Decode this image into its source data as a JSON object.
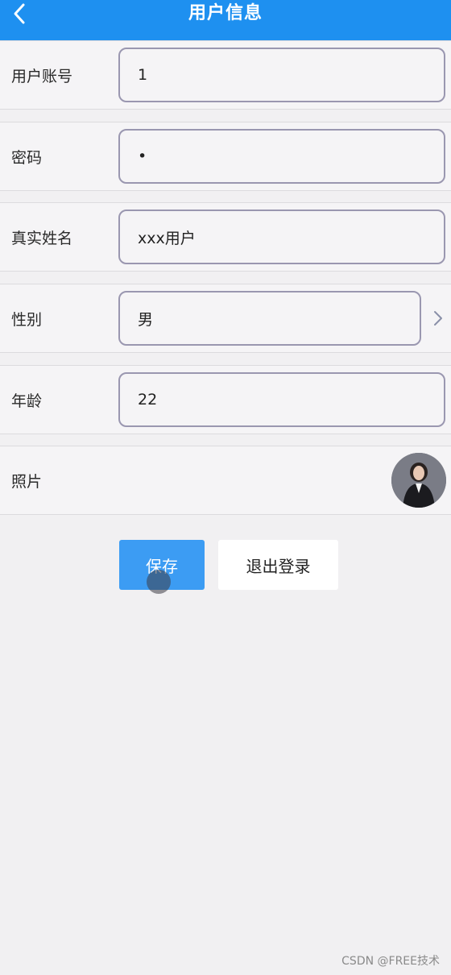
{
  "theme": {
    "accent": "#1e90f0"
  },
  "navbar": {
    "title": "用户信息",
    "back_icon": "chevron-left-icon"
  },
  "form": {
    "account": {
      "label": "用户账号",
      "value": "1"
    },
    "password": {
      "label": "密码",
      "value": "•"
    },
    "realname": {
      "label": "真实姓名",
      "value": "xxx用户"
    },
    "gender": {
      "label": "性别",
      "value": "男",
      "icon": "chevron-right-icon"
    },
    "age": {
      "label": "年龄",
      "value": "22"
    },
    "photo": {
      "label": "照片"
    }
  },
  "actions": {
    "save_label": "保存",
    "logout_label": "退出登录"
  },
  "watermark": "CSDN @FREE技术"
}
